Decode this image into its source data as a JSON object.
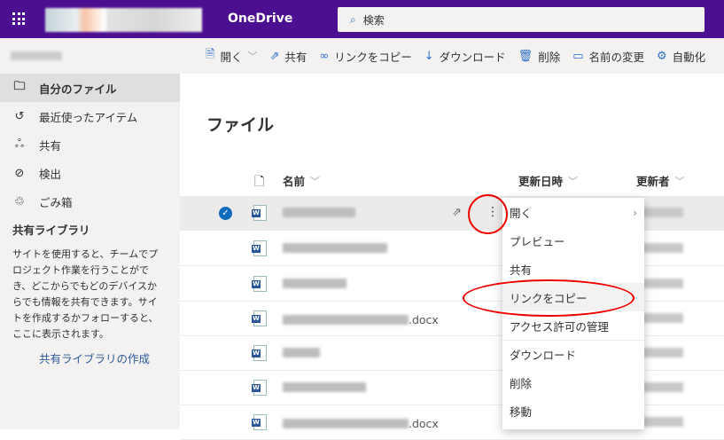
{
  "header": {
    "app_name": "OneDrive",
    "search_placeholder": "検索"
  },
  "commands": [
    {
      "label": "開く",
      "icon": "word-icon"
    },
    {
      "label": "共有",
      "icon": "share-icon"
    },
    {
      "label": "リンクをコピー",
      "icon": "link-icon"
    },
    {
      "label": "ダウンロード",
      "icon": "download-icon"
    },
    {
      "label": "削除",
      "icon": "trash-icon"
    },
    {
      "label": "名前の変更",
      "icon": "rename-icon"
    },
    {
      "label": "自動化",
      "icon": "automate-icon"
    }
  ],
  "sidebar": {
    "items": [
      {
        "label": "自分のファイル",
        "icon": "folder-icon"
      },
      {
        "label": "最近使ったアイテム",
        "icon": "history-icon"
      },
      {
        "label": "共有",
        "icon": "people-icon"
      },
      {
        "label": "検出",
        "icon": "compass-icon"
      },
      {
        "label": "ごみ箱",
        "icon": "recycle-bin-icon"
      }
    ],
    "library_heading": "共有ライブラリ",
    "library_desc": "サイトを使用すると、チームでプロジェクト作業を行うことができ、どこからでもどのデバイスからでも情報を共有できます。サイトを作成するかフォローすると、ここに表示されます。",
    "library_link": "共有ライブラリの作成"
  },
  "main": {
    "title": "ファイル",
    "columns": [
      "名前",
      "更新日時",
      "更新者"
    ],
    "files": [
      {
        "suffix": ""
      },
      {
        "suffix": ""
      },
      {
        "suffix": ""
      },
      {
        "suffix": ".docx"
      },
      {
        "suffix": ""
      },
      {
        "suffix": ""
      },
      {
        "suffix": ".docx"
      }
    ]
  },
  "context_menu": [
    "開く",
    "プレビュー",
    "共有",
    "リンクをコピー",
    "アクセス許可の管理",
    "ダウンロード",
    "削除",
    "移動"
  ]
}
